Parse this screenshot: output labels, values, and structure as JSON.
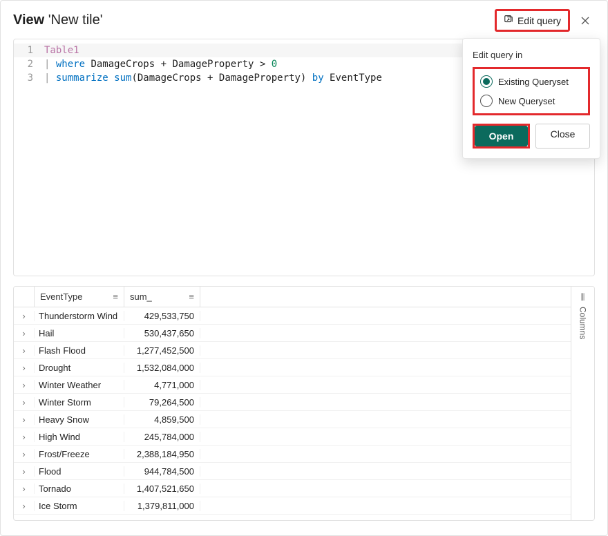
{
  "header": {
    "view_label": "View",
    "title": "'New tile'",
    "edit_query_label": "Edit query"
  },
  "code": {
    "lines": [
      {
        "num": "1",
        "tokens": [
          {
            "t": "Table1",
            "c": "tok-table"
          }
        ]
      },
      {
        "num": "2",
        "tokens": [
          {
            "t": "| ",
            "c": "tok-pipe"
          },
          {
            "t": "where",
            "c": "tok-kw"
          },
          {
            "t": " DamageCrops ",
            "c": "tok-id"
          },
          {
            "t": "+",
            "c": "tok-op"
          },
          {
            "t": " DamageProperty ",
            "c": "tok-id"
          },
          {
            "t": ">",
            "c": "tok-op"
          },
          {
            "t": " ",
            "c": "tok-id"
          },
          {
            "t": "0",
            "c": "tok-num"
          }
        ]
      },
      {
        "num": "3",
        "tokens": [
          {
            "t": "| ",
            "c": "tok-pipe"
          },
          {
            "t": "summarize",
            "c": "tok-kw"
          },
          {
            "t": " ",
            "c": "tok-id"
          },
          {
            "t": "sum",
            "c": "tok-func"
          },
          {
            "t": "(DamageCrops ",
            "c": "tok-id"
          },
          {
            "t": "+",
            "c": "tok-op"
          },
          {
            "t": " DamageProperty) ",
            "c": "tok-id"
          },
          {
            "t": "by",
            "c": "tok-by"
          },
          {
            "t": " EventType",
            "c": "tok-id"
          }
        ]
      }
    ]
  },
  "popover": {
    "title": "Edit query in",
    "option_existing": "Existing Queryset",
    "option_new": "New Queryset",
    "selected": "existing",
    "open_label": "Open",
    "close_label": "Close"
  },
  "table": {
    "col_event": "EventType",
    "col_sum": "sum_",
    "rows": [
      {
        "event": "Thunderstorm Wind",
        "sum": "429,533,750"
      },
      {
        "event": "Hail",
        "sum": "530,437,650"
      },
      {
        "event": "Flash Flood",
        "sum": "1,277,452,500"
      },
      {
        "event": "Drought",
        "sum": "1,532,084,000"
      },
      {
        "event": "Winter Weather",
        "sum": "4,771,000"
      },
      {
        "event": "Winter Storm",
        "sum": "79,264,500"
      },
      {
        "event": "Heavy Snow",
        "sum": "4,859,500"
      },
      {
        "event": "High Wind",
        "sum": "245,784,000"
      },
      {
        "event": "Frost/Freeze",
        "sum": "2,388,184,950"
      },
      {
        "event": "Flood",
        "sum": "944,784,500"
      },
      {
        "event": "Tornado",
        "sum": "1,407,521,650"
      },
      {
        "event": "Ice Storm",
        "sum": "1,379,811,000"
      }
    ]
  },
  "columns_panel_label": "Columns",
  "glyphs": {
    "hamburger": "≡",
    "chevron_right": "›"
  },
  "colors": {
    "highlight_red": "#e3292c",
    "accent_teal": "#0b6a5d"
  }
}
